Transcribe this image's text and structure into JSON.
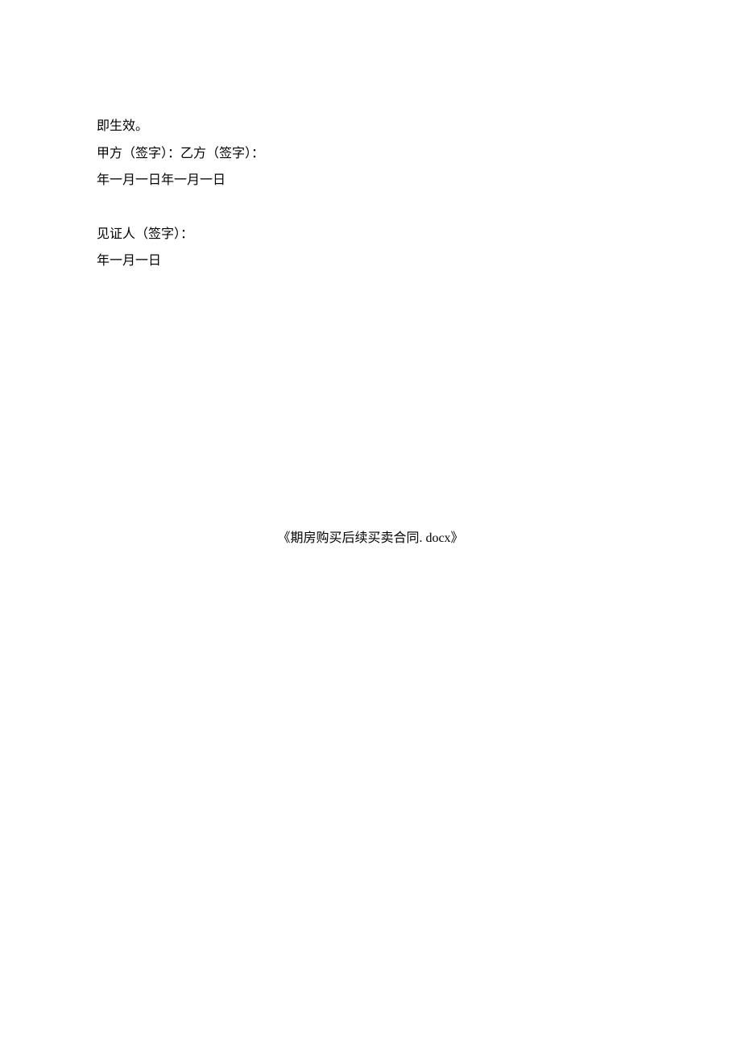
{
  "content": {
    "line1": "即生效。",
    "line2": "甲方（签字）：乙方（签字）：",
    "line3": "年一月一日年一月一日",
    "line4": "见证人（签字）：",
    "line5": "年一月一日"
  },
  "footer": "《期房购买后续买卖合同. docx》"
}
